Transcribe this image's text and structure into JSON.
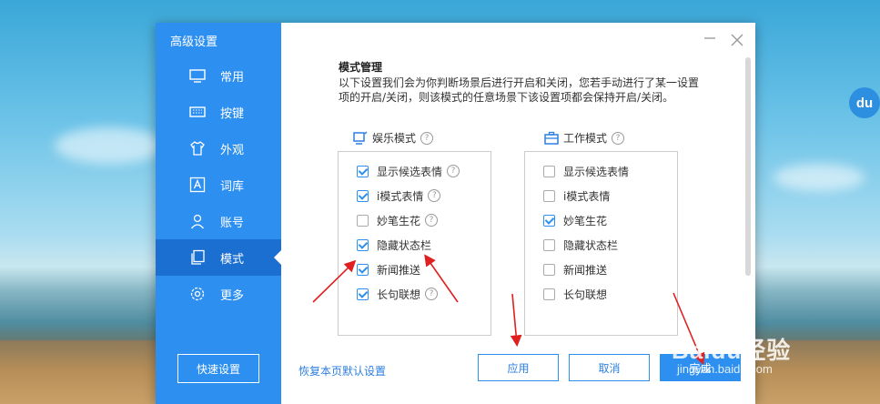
{
  "sidebar": {
    "title": "高级设置",
    "items": [
      {
        "label": "常用",
        "icon": "monitor-icon"
      },
      {
        "label": "按键",
        "icon": "keyboard-icon"
      },
      {
        "label": "外观",
        "icon": "shirt-icon"
      },
      {
        "label": "词库",
        "icon": "letter-a-icon"
      },
      {
        "label": "账号",
        "icon": "user-icon"
      },
      {
        "label": "模式",
        "icon": "window-copy-icon",
        "active": true
      },
      {
        "label": "更多",
        "icon": "gear-icon"
      }
    ],
    "quick_settings_label": "快速设置"
  },
  "main": {
    "section_title": "模式管理",
    "description": "以下设置我们会为你判断场景后进行开启和关闭，您若手动进行了某一设置项的开启/关闭，则该模式的任意场景下该设置项都会保持开启/关闭。",
    "entertainment": {
      "title": "娱乐模式",
      "options": [
        {
          "label": "显示候选表情",
          "checked": true,
          "help": true
        },
        {
          "label": "i模式表情",
          "checked": true,
          "help": true
        },
        {
          "label": "妙笔生花",
          "checked": false,
          "help": true
        },
        {
          "label": "隐藏状态栏",
          "checked": true,
          "help": false
        },
        {
          "label": "新闻推送",
          "checked": true,
          "help": false
        },
        {
          "label": "长句联想",
          "checked": true,
          "help": true
        }
      ]
    },
    "work": {
      "title": "工作模式",
      "options": [
        {
          "label": "显示候选表情",
          "checked": false
        },
        {
          "label": "i模式表情",
          "checked": false
        },
        {
          "label": "妙笔生花",
          "checked": true
        },
        {
          "label": "隐藏状态栏",
          "checked": false
        },
        {
          "label": "新闻推送",
          "checked": false
        },
        {
          "label": "长句联想",
          "checked": false
        }
      ]
    },
    "restore_label": "恢复本页默认设置",
    "apply_label": "应用",
    "cancel_label": "取消",
    "done_label": "完成",
    "help_glyph": "?"
  },
  "overlay": {
    "du_logo": "du",
    "watermark": "Baidu经验",
    "watermark_url": "jingyan.baidu.com"
  },
  "colors": {
    "accent": "#2d8ff0",
    "sidebar_active": "#1a6fd0",
    "annotation_arrow": "#e02020"
  }
}
